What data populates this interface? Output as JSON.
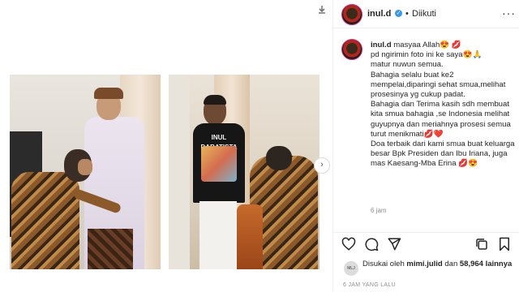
{
  "post": {
    "username": "inul.d",
    "follow_dot": "•",
    "follow_status": "Diikuti",
    "more_glyph": "···"
  },
  "caption": {
    "username": "inul.d",
    "lines": [
      "masyaa Allah😍 💋",
      "pd ngirimin foto ini ke saya😍🙏",
      "matur nuwun semua.",
      "Bahagia selalu buat ke2 mempelai,diparingi sehat smua,melihat prosesinya yg cukup padat.",
      "Bahagia dan Terima kasih sdh membuat kita smua bahagia ,se Indonesia melihat guyupnya dan meriahnya prosesi semua turut menikmati💋❤️",
      "Doa terbaik dari kami smua buat keluarga besar Bpk Presiden dan Ibu Iriana, juga mas Kaesang-Mba Erina 💋😍"
    ],
    "time": "6 jam"
  },
  "media": {
    "photo_left": "Groom in lilac attire with a man adjusting his outfit",
    "photo_right": "Man in black graphic t-shirt with a man in batik",
    "tshirt_text": "INUL DARATISTA"
  },
  "likes": {
    "prefix": "Disukai oleh ",
    "user": "mimi.julid",
    "mid": " dan ",
    "count": "58,964 lainnya",
    "avatar_label": "MLJ"
  },
  "date": "6 JAM YANG LALU",
  "icons": [
    "download-icon",
    "verified-icon",
    "more-icon",
    "next-icon",
    "heart-icon",
    "comment-icon",
    "share-icon",
    "bookmark-icon"
  ],
  "colors": {
    "verified": "#3897f0",
    "border": "#efefef",
    "secondary_text": "#8e8e8e"
  }
}
